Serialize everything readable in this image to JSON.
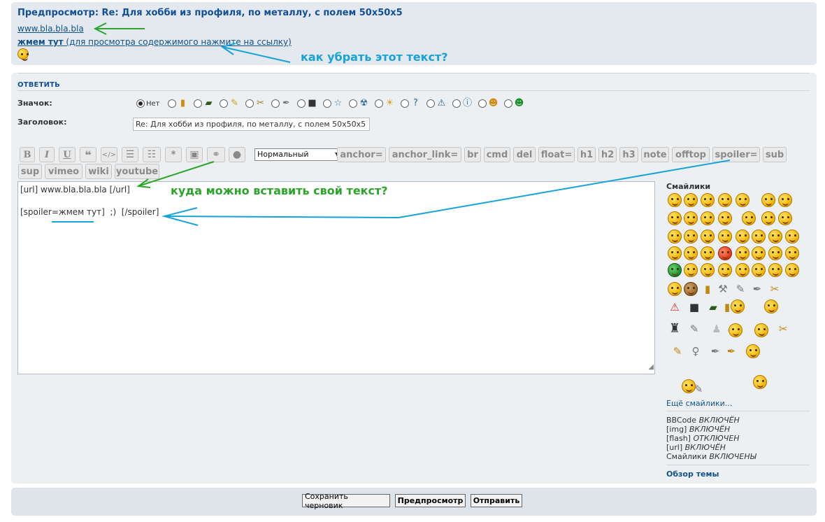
{
  "preview": {
    "title": "Предпросмотр: Re: Для хобби из профиля, по металлу, с полем 50x50x5",
    "link": "www.bla.bla.bla",
    "spoiler_bold": "жмем тут",
    "spoiler_rest": " (для просмотра содержимого нажмите на ссылку)",
    "smiley_icon": "wink-smiley-icon"
  },
  "reply": {
    "section_title": "ОТВЕТИТЬ",
    "icon_label": "Значок:",
    "icon_none": "Нет",
    "post_icons": [
      "bottle-icon",
      "tank-icon",
      "screwdriver-icon",
      "pliers-icon",
      "wrench-icon",
      "motor-icon",
      "star-icon",
      "radioactive-icon",
      "sun-icon",
      "question-icon",
      "warning-icon",
      "info-icon",
      "smiley-face-icon",
      "green-face-icon"
    ],
    "subject_label": "Заголовок:",
    "subject_value": "Re: Для хобби из профиля, по металлу, с полем 50x50x5"
  },
  "toolbar": {
    "buttons": [
      "B",
      "I",
      "U",
      "❝",
      "</>",
      "list",
      "olist",
      "*",
      "img",
      "link",
      "flash"
    ],
    "font_size": "Нормальный",
    "tags": [
      "anchor=",
      "anchor_link=",
      "br",
      "cmd",
      "del",
      "float=",
      "h1",
      "h2",
      "h3",
      "note",
      "offtop",
      "spoiler=",
      "sub",
      "sup",
      "vimeo",
      "wiki",
      "youtube"
    ]
  },
  "editor": {
    "line1": "[url] www.bla.bla.bla [/url]",
    "line3": "[spoiler=жмем тут]  ;)  [/spoiler]"
  },
  "smilies": {
    "title": "Смайлики",
    "more": "Ещё смайлики..."
  },
  "bbinfo": {
    "bbcode_label": "BBCode",
    "bbcode_state": "ВКЛЮЧЁН",
    "img_label": "[img]",
    "img_state": "ВКЛЮЧЁН",
    "flash_label": "[flash]",
    "flash_state": "ОТКЛЮЧЕН",
    "url_label": "[url]",
    "url_state": "ВКЛЮЧЁН",
    "smilies_label": "Смайлики",
    "smilies_state": "ВКЛЮЧЕНЫ"
  },
  "topic_review": "Обзор темы",
  "actions": {
    "save_draft": "Сохранить черновик",
    "preview": "Предпросмотр",
    "submit": "Отправить"
  },
  "annotations": {
    "remove_text": "как убрать этот текст?",
    "where_insert": "куда можно вставить свой текст?"
  },
  "colors": {
    "link": "#105289",
    "annotation_blue": "#17a2d8",
    "annotation_green": "#2aa52a"
  }
}
